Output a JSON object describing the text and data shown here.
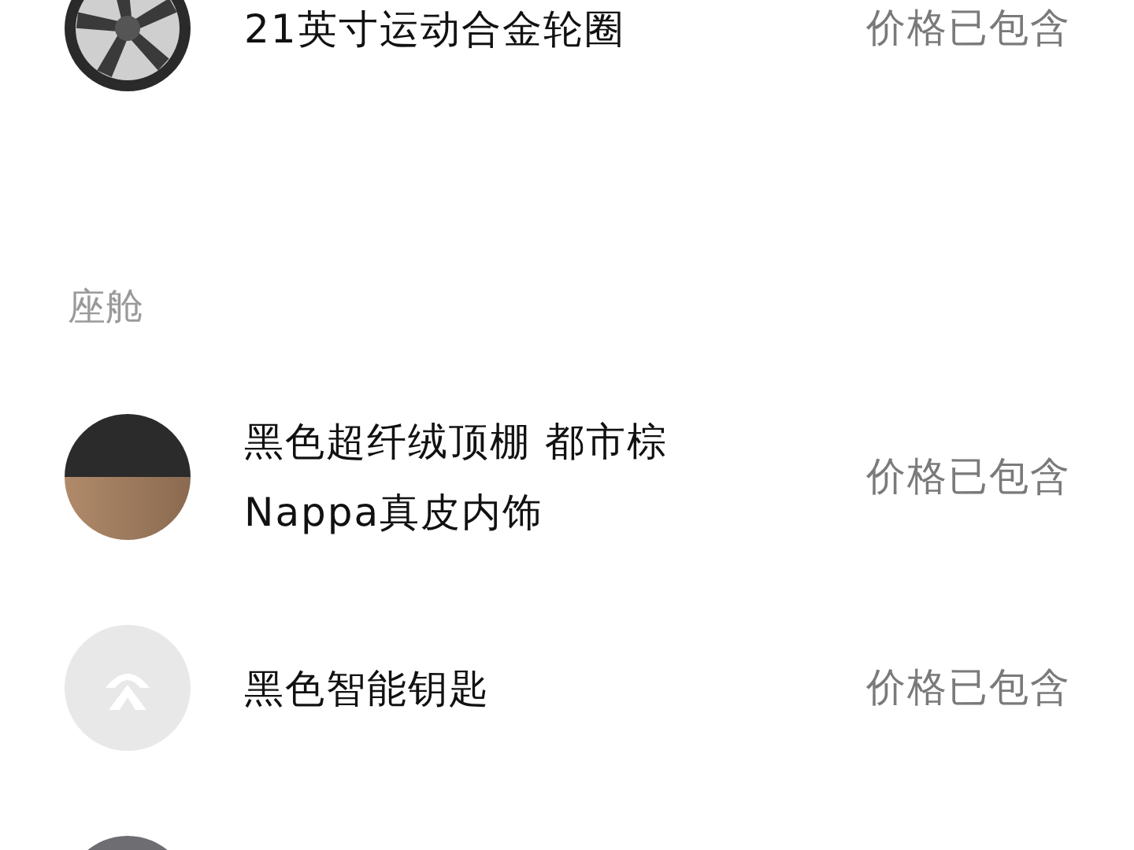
{
  "sections": [
    {
      "items": [
        {
          "kind": "wheel",
          "title": [
            "21英寸运动合金轮圈"
          ],
          "price": "价格已包含"
        }
      ]
    },
    {
      "heading": "座舱",
      "items": [
        {
          "kind": "two-tone",
          "title": [
            "黑色超纤绒顶棚 都市棕",
            "Nappa真皮内饰"
          ],
          "price": "价格已包含"
        },
        {
          "kind": "key",
          "title": [
            "黑色智能钥匙"
          ],
          "price": "价格已包含"
        },
        {
          "kind": "gray"
        }
      ]
    }
  ]
}
